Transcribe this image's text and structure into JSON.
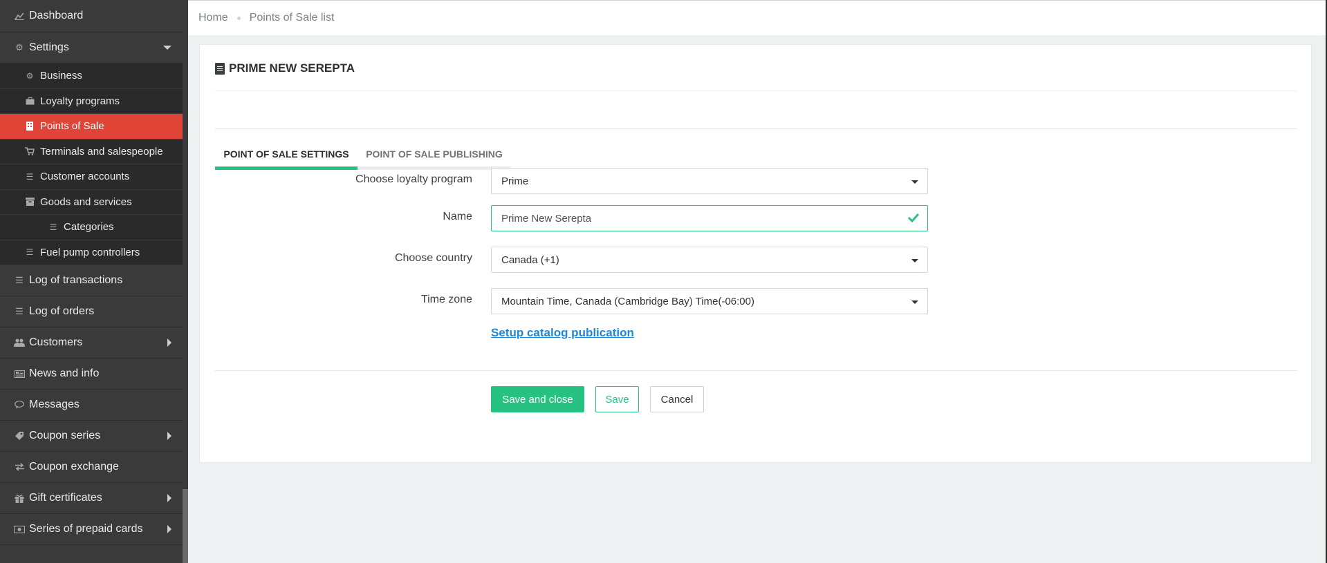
{
  "sidebar": {
    "dashboard": {
      "label": "Dashboard",
      "icon": "chart-icon"
    },
    "settings": {
      "label": "Settings",
      "icon": "gear-icon",
      "children": {
        "business": {
          "label": "Business",
          "icon": "gear-icon"
        },
        "loyalty": {
          "label": "Loyalty programs",
          "icon": "briefcase-icon"
        },
        "pos": {
          "label": "Points of Sale",
          "icon": "building-icon"
        },
        "terminals": {
          "label": "Terminals and salespeople",
          "icon": "cart-icon"
        },
        "customer_accounts": {
          "label": "Customer accounts",
          "icon": "list-icon"
        },
        "goods": {
          "label": "Goods and services",
          "icon": "archive-icon"
        },
        "categories": {
          "label": "Categories",
          "icon": "list-icon"
        },
        "fuel": {
          "label": "Fuel pump controllers",
          "icon": "list-icon"
        }
      }
    },
    "log_transactions": {
      "label": "Log of transactions",
      "icon": "list-icon"
    },
    "log_orders": {
      "label": "Log of orders",
      "icon": "list-icon"
    },
    "customers": {
      "label": "Customers",
      "icon": "users-icon"
    },
    "news": {
      "label": "News and info",
      "icon": "newspaper-icon"
    },
    "messages": {
      "label": "Messages",
      "icon": "comment-icon"
    },
    "coupon_series": {
      "label": "Coupon series",
      "icon": "tag-icon"
    },
    "coupon_exchange": {
      "label": "Coupon exchange",
      "icon": "exchange-icon"
    },
    "gift_certificates": {
      "label": "Gift certificates",
      "icon": "gift-icon"
    },
    "prepaid_cards": {
      "label": "Series of prepaid cards",
      "icon": "money-icon"
    }
  },
  "breadcrumb": {
    "home": "Home",
    "current": "Points of Sale list"
  },
  "card": {
    "title": "PRIME NEW SEREPTA",
    "tabs": {
      "settings": "POINT OF SALE SETTINGS",
      "publishing": "POINT OF SALE PUBLISHING"
    }
  },
  "form": {
    "loyalty_label": "Choose loyalty program",
    "loyalty_value": "Prime",
    "name_label": "Name",
    "name_value": "Prime New Serepta",
    "country_label": "Choose country",
    "country_value": "Canada (+1)",
    "timezone_label": "Time zone",
    "timezone_value": "Mountain Time, Canada (Cambridge Bay) Time(-06:00)",
    "catalog_link": "Setup catalog publication"
  },
  "buttons": {
    "save_close": "Save and close",
    "save": "Save",
    "cancel": "Cancel"
  },
  "colors": {
    "accent_green": "#27c281",
    "active_red": "#e04436",
    "link_blue": "#1e88d8",
    "sidebar_bg": "#3a3a3a"
  }
}
